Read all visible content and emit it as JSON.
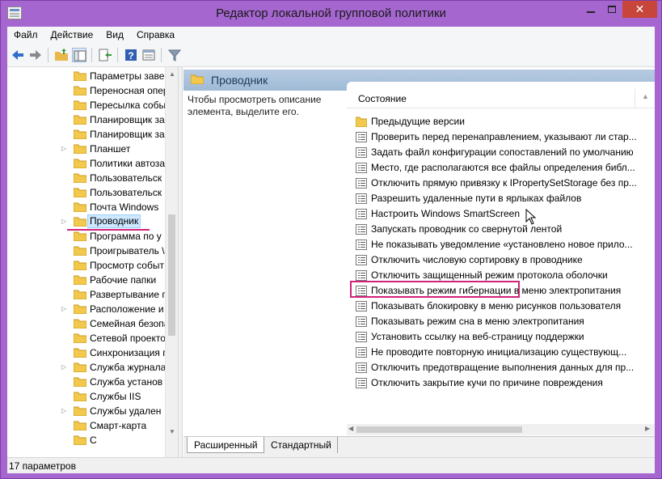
{
  "window": {
    "title": "Редактор локальной групповой политики",
    "close_symbol": "✕"
  },
  "menu": [
    "Файл",
    "Действие",
    "Вид",
    "Справка"
  ],
  "toolbar": {
    "icons": [
      "back-icon",
      "forward-icon",
      "up-folder-icon",
      "show-hide-tree-icon",
      "export-list-icon",
      "help-icon",
      "properties-icon",
      "filter-icon"
    ]
  },
  "tree": {
    "items": [
      {
        "label": "Параметры завер",
        "expandable": false
      },
      {
        "label": "Переносная опер",
        "expandable": false
      },
      {
        "label": "Пересылка собы",
        "expandable": false
      },
      {
        "label": "Планировщик за",
        "expandable": false
      },
      {
        "label": "Планировщик за",
        "expandable": false
      },
      {
        "label": "Планшет",
        "expandable": true
      },
      {
        "label": "Политики автоза",
        "expandable": false
      },
      {
        "label": "Пользовательск",
        "expandable": false
      },
      {
        "label": "Пользовательск",
        "expandable": false
      },
      {
        "label": "Почта Windows",
        "expandable": false
      },
      {
        "label": "Проводник",
        "expandable": true,
        "selected": true
      },
      {
        "label": "Программа по у",
        "expandable": false
      },
      {
        "label": "Проигрыватель \\",
        "expandable": false
      },
      {
        "label": "Просмотр событ",
        "expandable": false
      },
      {
        "label": "Рабочие папки",
        "expandable": false
      },
      {
        "label": "Развертывание п",
        "expandable": false
      },
      {
        "label": "Расположение и",
        "expandable": true
      },
      {
        "label": "Семейная безопа",
        "expandable": false
      },
      {
        "label": "Сетевой проекто",
        "expandable": false
      },
      {
        "label": "Синхронизация г",
        "expandable": false
      },
      {
        "label": "Служба журнала",
        "expandable": true
      },
      {
        "label": "Служба установ",
        "expandable": false
      },
      {
        "label": "Службы IIS",
        "expandable": false
      },
      {
        "label": "Службы удален",
        "expandable": true
      },
      {
        "label": "Смарт-карта",
        "expandable": false
      },
      {
        "label": "С",
        "expandable": false
      }
    ]
  },
  "right_pane": {
    "header": "Проводник",
    "description": "Чтобы просмотреть описание элемента, выделите его.",
    "column_header": "Состояние",
    "items": [
      {
        "label": "Предыдущие версии",
        "kind": "folder"
      },
      {
        "label": "Проверить перед перенаправлением, указывают ли стар...",
        "kind": "setting"
      },
      {
        "label": "Задать файл конфигурации сопоставлений по умолчанию",
        "kind": "setting"
      },
      {
        "label": "Место, где располагаются все файлы определения библ...",
        "kind": "setting"
      },
      {
        "label": "Отключить прямую привязку к IPropertySetStorage без пр...",
        "kind": "setting"
      },
      {
        "label": "Разрешить удаленные пути в ярлыках файлов",
        "kind": "setting"
      },
      {
        "label": "Настроить Windows SmartScreen",
        "kind": "setting",
        "highlighted": true
      },
      {
        "label": "Запускать проводник со свернутой лентой",
        "kind": "setting"
      },
      {
        "label": "Не показывать уведомление «установлено новое прило...",
        "kind": "setting"
      },
      {
        "label": "Отключить числовую сортировку в проводнике",
        "kind": "setting"
      },
      {
        "label": "Отключить защищенный режим протокола оболочки",
        "kind": "setting"
      },
      {
        "label": "Показывать режим гибернации в меню электропитания",
        "kind": "setting"
      },
      {
        "label": "Показывать блокировку в меню рисунков пользователя",
        "kind": "setting"
      },
      {
        "label": "Показывать режим сна в меню электропитания",
        "kind": "setting"
      },
      {
        "label": "Установить ссылку на веб-страницу поддержки",
        "kind": "setting"
      },
      {
        "label": "Не проводите повторную инициализацию существующ...",
        "kind": "setting"
      },
      {
        "label": "Отключить предотвращение выполнения данных для пр...",
        "kind": "setting"
      },
      {
        "label": "Отключить закрытие кучи по причине повреждения",
        "kind": "setting"
      }
    ],
    "tabs": [
      "Расширенный",
      "Стандартный"
    ]
  },
  "status": "17 параметров",
  "colors": {
    "window_frame": "#a566cf",
    "highlight": "#d1237a",
    "pane_header": "#b6cbe2",
    "folder": "#f2c94c"
  }
}
